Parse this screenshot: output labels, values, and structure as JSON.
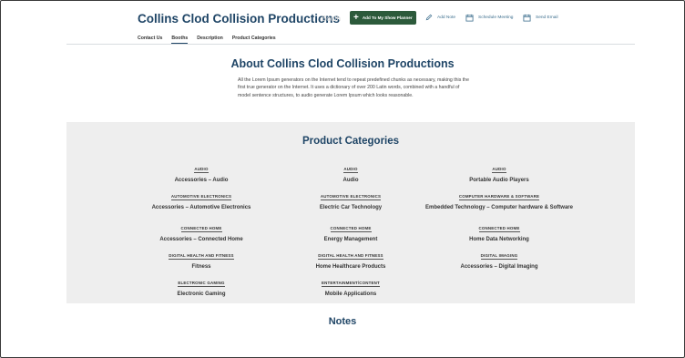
{
  "header": {
    "company_name": "Collins Clod Collision Productions",
    "ghost_label": "Booth",
    "add_planner_label": "Add To My Show Planner",
    "add_note_label": "Add Note",
    "schedule_label": "Schedule Meeting",
    "email_label": "Send Email"
  },
  "tabs": [
    {
      "label": "Contact Us"
    },
    {
      "label": "Booths"
    },
    {
      "label": "Description"
    },
    {
      "label": "Product Categories"
    }
  ],
  "about": {
    "title": "About Collins Clod Collision Productions",
    "body": "All the Lorem Ipsum generators on the Internet tend to repeat predefined chunks as necessary, making this the first true generator on the Internet. It uses a dictionary of over 200 Latin words, combined with a handful of model sentence structures, to audio generate Lorem Ipsum which looks reasonable."
  },
  "categories": {
    "title": "Product Categories",
    "items": [
      {
        "group": "AUDIO",
        "name": "Accessories – Audio"
      },
      {
        "group": "AUDIO",
        "name": "Audio"
      },
      {
        "group": "AUDIO",
        "name": "Portable Audio Players"
      },
      {
        "group": "AUTOMOTIVE ELECTRONICS",
        "name": "Accessories – Automotive Electronics"
      },
      {
        "group": "AUTOMOTIVE ELECTRONICS",
        "name": "Electric Car Technology"
      },
      {
        "group": "COMPUTER HARDWARE & SOFTWARE",
        "name": "Embedded Technology – Computer hardware & Software"
      },
      {
        "group": "CONNECTED HOME",
        "name": "Accessories – Connected Home"
      },
      {
        "group": "CONNECTED HOME",
        "name": "Energy Management"
      },
      {
        "group": "CONNECTED HOME",
        "name": "Home Data Networking"
      },
      {
        "group": "DIGITAL HEALTH AND FITNESS",
        "name": "Fitness"
      },
      {
        "group": "DIGITAL HEALTH AND FITNESS",
        "name": "Home Healthcare Products"
      },
      {
        "group": "DIGITAL IMAGING",
        "name": "Accessories – Digital Imaging"
      },
      {
        "group": "ELECTRONIC GAMING",
        "name": "Electronic Gaming"
      },
      {
        "group": "ENTERTAINMENT/CONTENT",
        "name": "Mobile Applications"
      }
    ]
  },
  "notes": {
    "title": "Notes"
  },
  "colors": {
    "brand_blue": "#1f4566",
    "planner_green": "#2c5a3b",
    "link_blue": "#3d6f8e",
    "panel_gray": "#eeeeee"
  },
  "icons": [
    "plus-icon",
    "pencil-icon",
    "calendar-icon",
    "calendar-icon"
  ]
}
